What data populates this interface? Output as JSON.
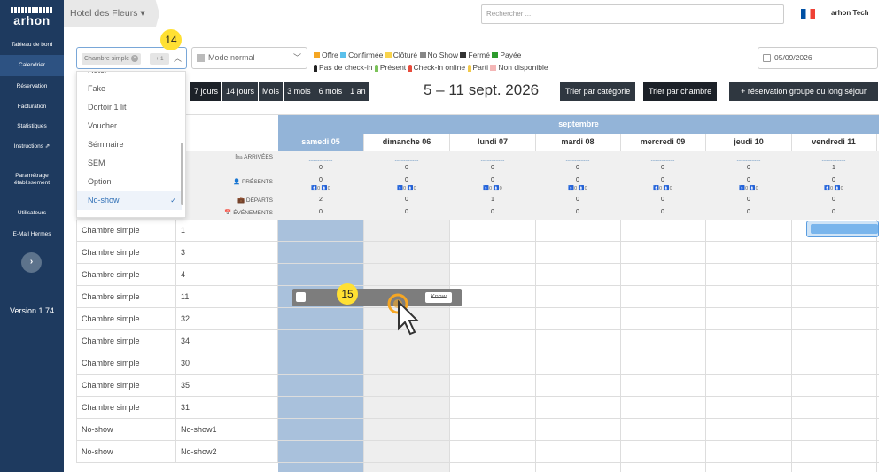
{
  "app": {
    "logo_top": "ARHON",
    "logo_word": "arhon",
    "hotel": "Hotel des Fleurs",
    "search_placeholder": "Rechercher ...",
    "user": "arhon Tech"
  },
  "sidebar": {
    "items": [
      {
        "label": "Tableau de bord"
      },
      {
        "label": "Calendrier"
      },
      {
        "label": "Réservation"
      },
      {
        "label": "Facturation"
      },
      {
        "label": "Statistiques"
      },
      {
        "label": "Instructions"
      },
      {
        "label": "Paramétrage"
      },
      {
        "label": "établissement"
      },
      {
        "label": "Utilisateurs"
      },
      {
        "label": "E-Mail Hermes"
      }
    ],
    "toggle": "›",
    "version": "Version 1.74"
  },
  "filters": {
    "category_tag": "Chambre simple",
    "tag_remove": "×",
    "more_count": "+ 1",
    "mode": "Mode normal",
    "date": "05/09/2026"
  },
  "legend": {
    "items": [
      {
        "label": "Offre",
        "color": "#f5a623"
      },
      {
        "label": "Confirmée",
        "color": "#5bc0eb"
      },
      {
        "label": "Clôturé",
        "color": "#f8d34c"
      },
      {
        "label": "No Show",
        "color": "#888888"
      },
      {
        "label": "Fermé",
        "color": "#333333"
      },
      {
        "label": "Payée",
        "color": "#2e9b2e"
      }
    ],
    "items2": [
      {
        "label": "Pas de check-in",
        "color": "#222222"
      },
      {
        "label": "Présent",
        "color": "#7cc35a"
      },
      {
        "label": "Check-in online",
        "color": "#e74c3c"
      },
      {
        "label": "Parti",
        "color": "#f2c94c"
      },
      {
        "label": "Non disponible",
        "color": "#f4b6b6"
      }
    ]
  },
  "dropdown": {
    "items": [
      "Hôtel",
      "Fake",
      "Dortoir 1 lit",
      "Voucher",
      "Séminaire",
      "SEM",
      "Option",
      "No-show"
    ],
    "selected": "No-show",
    "check": "✓"
  },
  "periods": [
    "7 jours",
    "14 jours",
    "Mois",
    "3 mois",
    "6 mois",
    "1 an"
  ],
  "week_title": "5 – 11 sept. 2026",
  "sort": {
    "category": "Trier par catégorie",
    "room": "Trier par chambre"
  },
  "group_button": "+ réservation groupe ou long séjour",
  "calendar": {
    "month": "septembre",
    "days": [
      "samedi 05",
      "dimanche 06",
      "lundi 07",
      "mardi 08",
      "mercredi 09",
      "jeudi 10",
      "vendredi 11"
    ],
    "stat_labels": {
      "arrivals": "ARRIVÉES",
      "present": "PRÉSENTS",
      "departures": "DÉPARTS",
      "events": "ÉVÉNEMENTS"
    },
    "arrival_dash": "----------------",
    "arrivals": [
      "0",
      "0",
      "0",
      "0",
      "0",
      "0",
      "1"
    ],
    "present": [
      "0",
      "0",
      "0",
      "0",
      "0",
      "0",
      "0"
    ],
    "present_split": [
      "🚹0 🚺0",
      "🚹0 🚺0",
      "🚹0 🚺0",
      "🚹0 🚺0",
      "🚹0 🚺0",
      "🚹0 🚺0",
      "🚹0 🚺0"
    ],
    "departures": [
      "2",
      "0",
      "1",
      "0",
      "0",
      "0",
      "0"
    ],
    "events": [
      "0",
      "0",
      "0",
      "0",
      "0",
      "0",
      "0"
    ]
  },
  "rooms": [
    {
      "category": "Chambre simple",
      "room": "1"
    },
    {
      "category": "Chambre simple",
      "room": "3"
    },
    {
      "category": "Chambre simple",
      "room": "4"
    },
    {
      "category": "Chambre simple",
      "room": "11"
    },
    {
      "category": "Chambre simple",
      "room": "32"
    },
    {
      "category": "Chambre simple",
      "room": "34"
    },
    {
      "category": "Chambre simple",
      "room": "30"
    },
    {
      "category": "Chambre simple",
      "room": "35"
    },
    {
      "category": "Chambre simple",
      "room": "31"
    },
    {
      "category": "No-show",
      "room": "No-show1"
    },
    {
      "category": "No-show",
      "room": "No-show2"
    }
  ],
  "drag_item": {
    "label": "Know"
  },
  "steps": {
    "a": "14",
    "b": "15"
  }
}
